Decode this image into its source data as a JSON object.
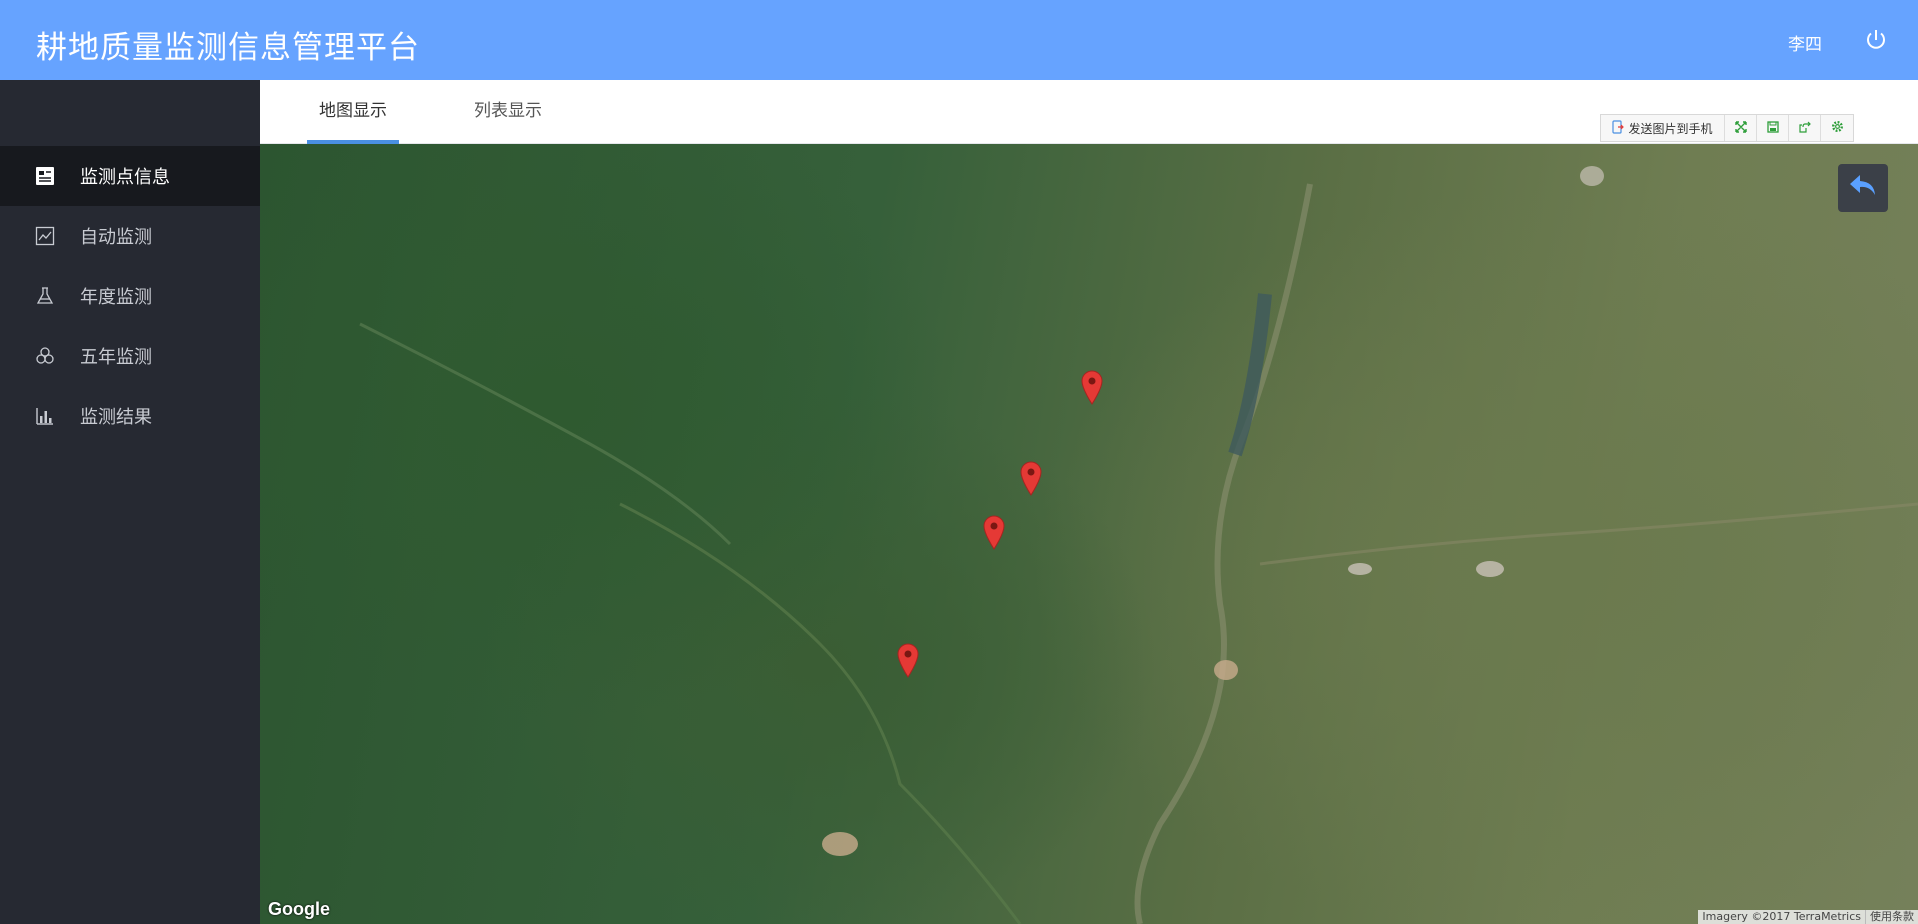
{
  "header": {
    "title": "耕地质量监测信息管理平台",
    "user": "李四",
    "background_color": "#66a3ff",
    "power_icon": "power-icon"
  },
  "sidebar": {
    "items": [
      {
        "label": "监测点信息",
        "icon": "list-card-icon",
        "active": true
      },
      {
        "label": "自动监测",
        "icon": "line-chart-icon",
        "active": false
      },
      {
        "label": "年度监测",
        "icon": "flask-icon",
        "active": false
      },
      {
        "label": "五年监测",
        "icon": "circles-icon",
        "active": false
      },
      {
        "label": "监测结果",
        "icon": "bar-chart-icon",
        "active": false
      }
    ]
  },
  "tabs": [
    {
      "label": "地图显示",
      "active": true
    },
    {
      "label": "列表显示",
      "active": false
    }
  ],
  "toolbar": {
    "send_label": "发送图片到手机",
    "icons": [
      "phone-send-icon",
      "fullscreen-icon",
      "save-icon",
      "export-icon",
      "settings-icon"
    ]
  },
  "map": {
    "logo": "Google",
    "imagery_credit": "Imagery ©2017 TerraMetrics",
    "terms": "使用条款",
    "marker_count": 4,
    "accent_color": "#e53935"
  }
}
